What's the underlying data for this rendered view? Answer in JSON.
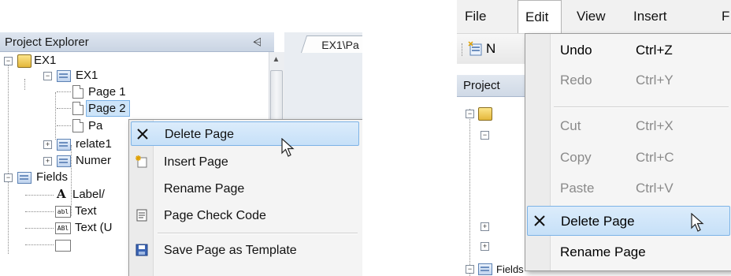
{
  "left": {
    "explorer_title": "Project Explorer",
    "pin_glyph": "↑",
    "doc_tab": "EX1\\Pa",
    "tree": {
      "root": "EX1",
      "form": "EX1",
      "page1": "Page 1",
      "page2": "Page 2",
      "page3": "Pa",
      "relate": "relate1",
      "numer": "Numer",
      "fields": "Fields",
      "label_item": "Label/",
      "text_item": "Text",
      "text_upper_item": "Text (U"
    },
    "icons": {
      "abl": "abl",
      "ABL": "ABl",
      "A": "A"
    },
    "context_menu": [
      {
        "label": "Delete Page",
        "icon": "delete-x-icon",
        "highlighted": true
      },
      {
        "label": "Insert Page",
        "icon": "insert-page-icon"
      },
      {
        "label": "Rename Page",
        "icon": ""
      },
      {
        "label": "Page Check Code",
        "icon": "check-code-icon"
      },
      {
        "label": "Save Page as Template",
        "icon": "save-disk-icon"
      }
    ]
  },
  "right": {
    "menubar": [
      "File",
      "Edit",
      "View",
      "Insert",
      "F"
    ],
    "toolbar_letter": "N",
    "project_header": "Project",
    "fields_label": "Fields",
    "edit_menu": {
      "undo": {
        "label": "Undo",
        "shortcut": "Ctrl+Z"
      },
      "redo": {
        "label": "Redo",
        "shortcut": "Ctrl+Y"
      },
      "cut": {
        "label": "Cut",
        "shortcut": "Ctrl+X"
      },
      "copy": {
        "label": "Copy",
        "shortcut": "Ctrl+C"
      },
      "paste": {
        "label": "Paste",
        "shortcut": "Ctrl+V"
      },
      "delete_page": {
        "label": "Delete Page"
      },
      "rename_page": {
        "label": "Rename Page"
      }
    }
  },
  "colors": {
    "highlight_bg": "#c6e0f8",
    "highlight_border": "#7db3e6",
    "disabled_text": "#8a8a8a"
  }
}
